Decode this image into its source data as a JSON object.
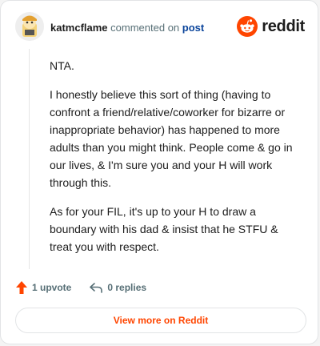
{
  "comment": {
    "username": "katmcflame",
    "verb": "commented on",
    "post_link_label": "post",
    "paragraphs": [
      "NTA.",
      "I honestly believe this sort of thing (having to confront a friend/relative/coworker for bizarre or inappropriate behavior) has happened to more adults than you might think. People come & go in our lives, & I'm sure you and your H will work through this.",
      "As for your FIL, it's up to your H to draw a boundary with his dad & insist that he STFU & treat you with respect."
    ]
  },
  "brand": {
    "name": "reddit",
    "color": "#ff4500"
  },
  "actions": {
    "upvote_label": "1 upvote",
    "reply_label": "0 replies"
  },
  "footer": {
    "view_more_label": "View more on Reddit"
  },
  "icons": {
    "avatar": "avatar",
    "logo": "reddit-snoo-icon",
    "upvote": "upvote-arrow-icon",
    "reply": "reply-arrow-icon"
  }
}
